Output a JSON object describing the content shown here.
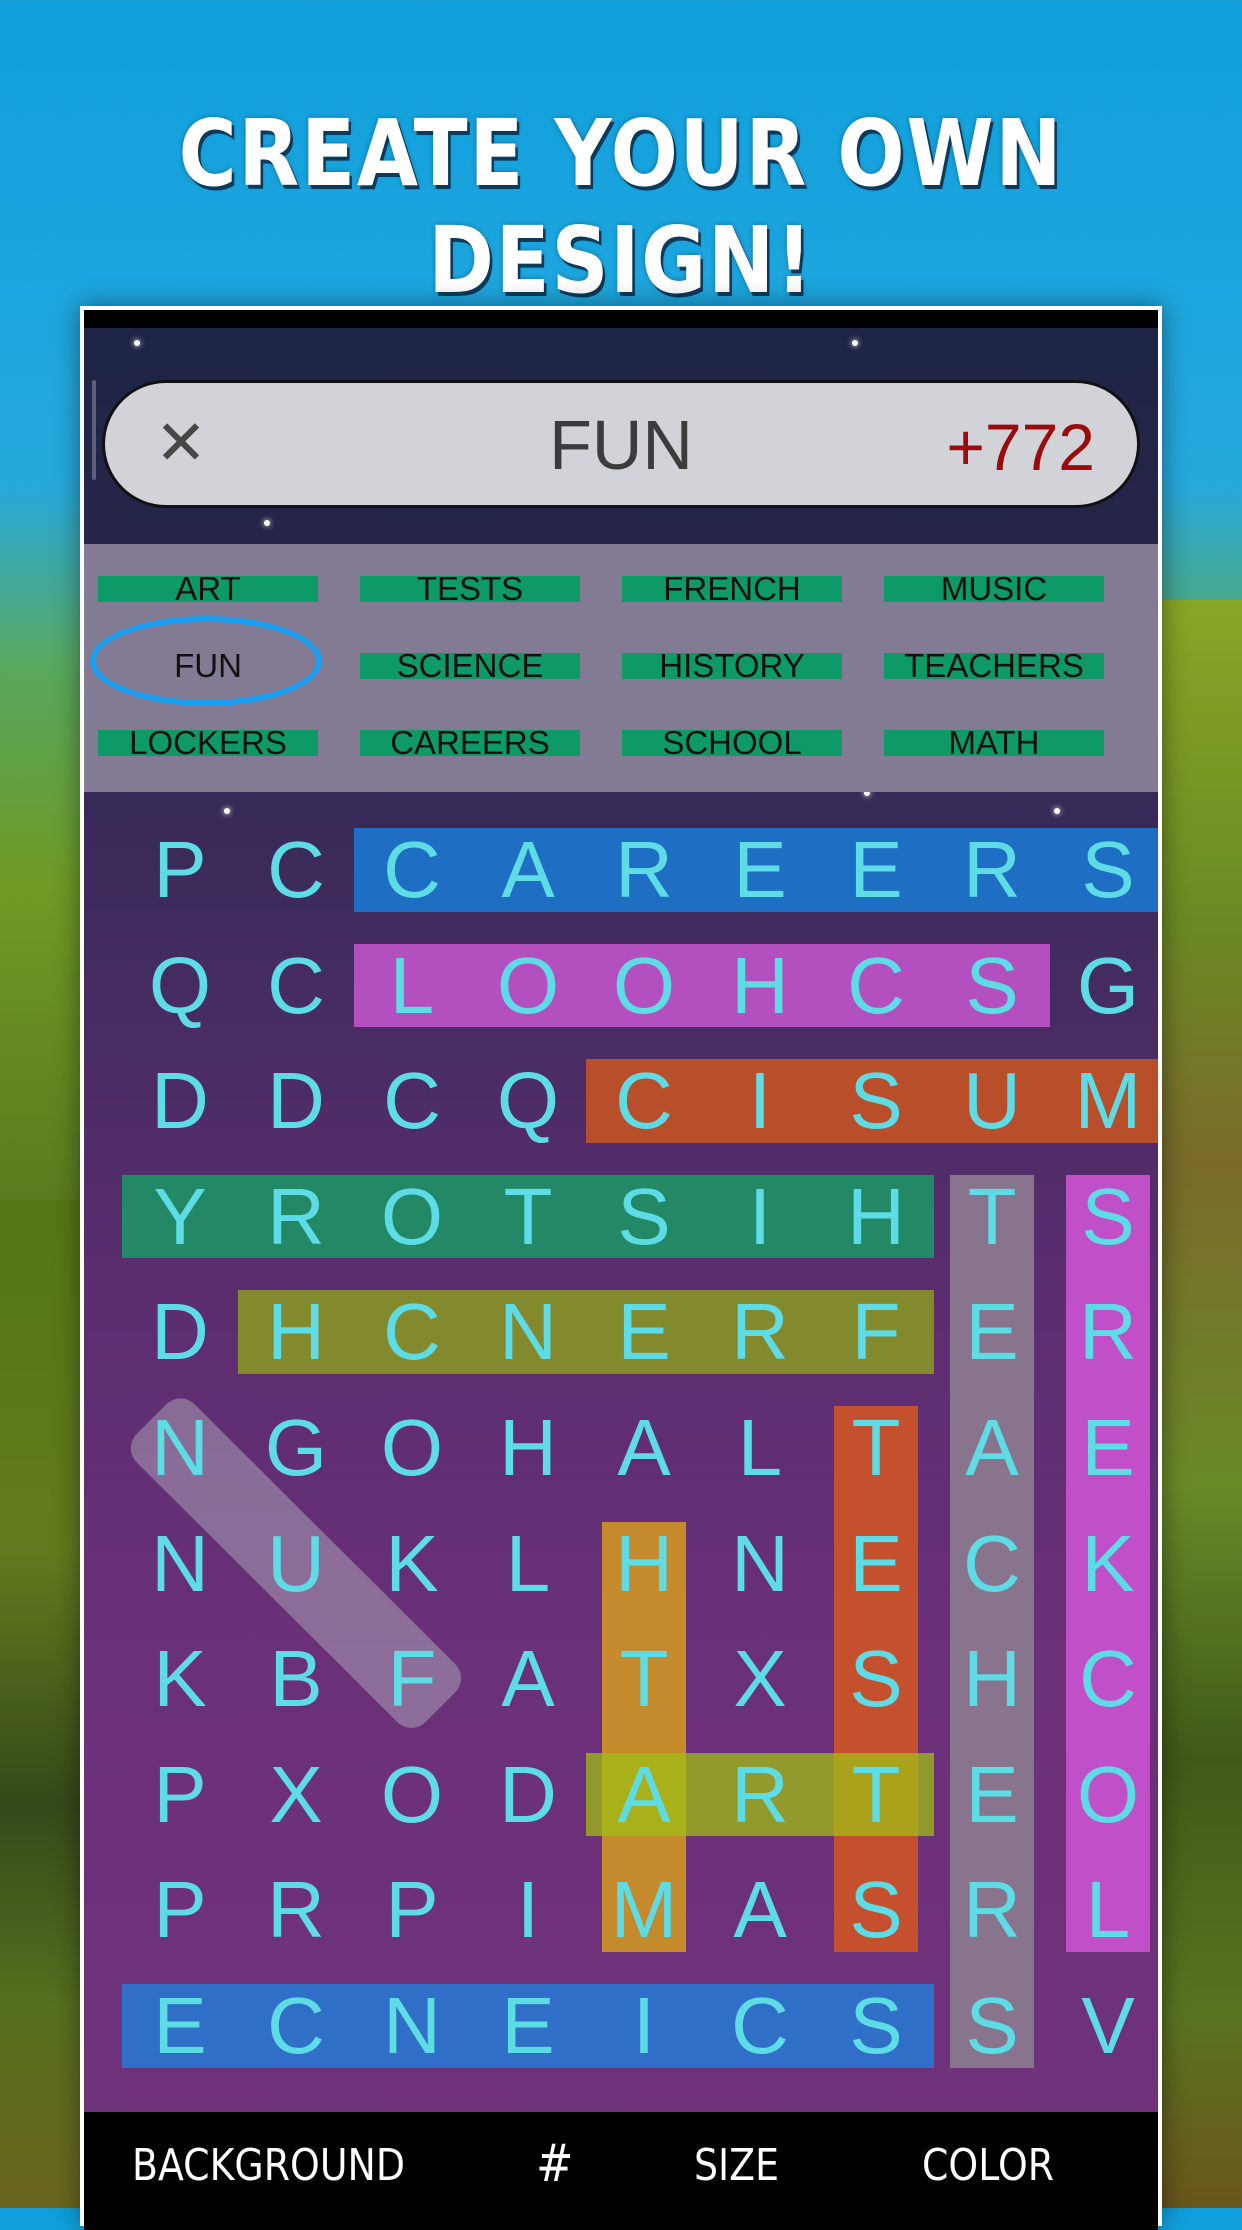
{
  "headline": "CREATE YOUR OWN DESIGN!",
  "header": {
    "close_icon": "close-icon",
    "close_glyph": "✕",
    "current_word": "FUN",
    "score": "+772"
  },
  "word_bank": {
    "selected": "FUN",
    "items": [
      {
        "label": "ART",
        "found": true
      },
      {
        "label": "TESTS",
        "found": true
      },
      {
        "label": "FRENCH",
        "found": true
      },
      {
        "label": "MUSIC",
        "found": true
      },
      {
        "label": "FUN",
        "found": false,
        "selected": true
      },
      {
        "label": "SCIENCE",
        "found": true
      },
      {
        "label": "HISTORY",
        "found": true
      },
      {
        "label": "TEACHERS",
        "found": true
      },
      {
        "label": "LOCKERS",
        "found": true
      },
      {
        "label": "CAREERS",
        "found": true
      },
      {
        "label": "SCHOOL",
        "found": true
      },
      {
        "label": "MATH",
        "found": true
      }
    ]
  },
  "grid": {
    "rows": [
      "PCCAREERS",
      "QCLOOHCSG",
      "DDCQCISUM",
      "YROTSIHTS",
      "DHCNERFER",
      "NGOHALTAE",
      "NUKLHNECK",
      "KBFATXSHC",
      "PXODARTEO",
      "PRPIMASRL",
      "ECNEICSSV"
    ],
    "letter_color": "#5ddce6",
    "highlights": [
      {
        "word": "CAREERS",
        "start": [
          0,
          2
        ],
        "end": [
          0,
          8
        ],
        "color": "#1e6fc4"
      },
      {
        "word": "SCHOOL",
        "start": [
          1,
          7
        ],
        "end": [
          1,
          2
        ],
        "color": "#b44fc0"
      },
      {
        "word": "MUSIC",
        "start": [
          2,
          8
        ],
        "end": [
          2,
          4
        ],
        "color": "#b84e2a"
      },
      {
        "word": "HISTORY",
        "start": [
          3,
          6
        ],
        "end": [
          3,
          0
        ],
        "color": "#228866"
      },
      {
        "word": "FRENCH",
        "start": [
          4,
          6
        ],
        "end": [
          4,
          1
        ],
        "color": "#838a2e"
      },
      {
        "word": "TEACHERS",
        "start": [
          3,
          7
        ],
        "end": [
          10,
          7
        ],
        "color": "#88748c"
      },
      {
        "word": "LOCKERS",
        "start": [
          9,
          8
        ],
        "end": [
          3,
          8
        ],
        "color": "#c14fc8"
      },
      {
        "word": "TESTS",
        "start": [
          5,
          6
        ],
        "end": [
          9,
          6
        ],
        "color": "#c4502e"
      },
      {
        "word": "MATH",
        "start": [
          9,
          4
        ],
        "end": [
          6,
          4
        ],
        "color": "#c48a2c"
      },
      {
        "word": "SCIENCE",
        "start": [
          10,
          6
        ],
        "end": [
          10,
          0
        ],
        "color": "#2f6fc8"
      },
      {
        "word": "ART",
        "start": [
          8,
          4
        ],
        "end": [
          8,
          6
        ],
        "color": "rgba(160,190,20,0.75)"
      },
      {
        "word": "FUN",
        "start": [
          7,
          2
        ],
        "end": [
          5,
          0
        ],
        "color": "rgba(170,160,180,0.55)",
        "diagonal": true
      }
    ]
  },
  "toolbar": {
    "items": [
      {
        "label": "BACKGROUND",
        "name": "background-button"
      },
      {
        "label": "#",
        "name": "grid-number-button"
      },
      {
        "label": "SIZE",
        "name": "size-button"
      },
      {
        "label": "COLOR",
        "name": "color-button"
      }
    ]
  }
}
